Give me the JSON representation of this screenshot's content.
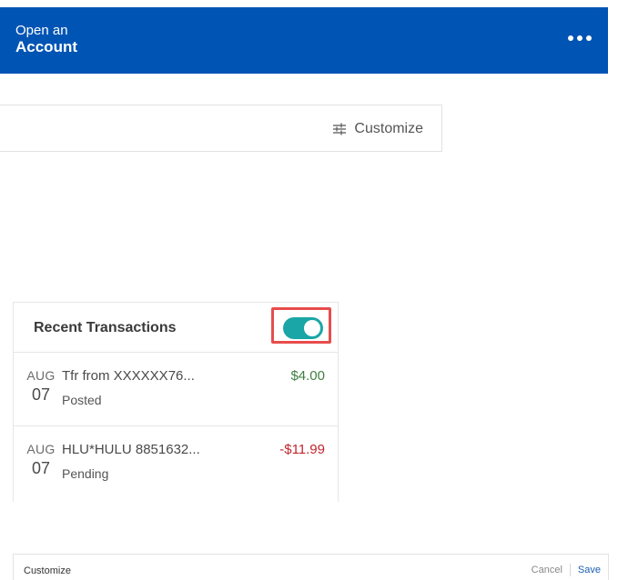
{
  "header": {
    "title_line1": "Open an",
    "title_line2": "Account",
    "menu_icon": "more-horizontal-icon",
    "background": "#0054b4"
  },
  "customize_bar": {
    "label": "Customize",
    "icon": "sliders-icon"
  },
  "transactions": {
    "title": "Recent Transactions",
    "toggle_on": true,
    "toggle_color": "#1aa6a6",
    "items": [
      {
        "month": "AUG",
        "day": "07",
        "description": "Tfr from XXXXXX76...",
        "status": "Posted",
        "amount": "$4.00"
      },
      {
        "month": "AUG",
        "day": "07",
        "description": "HLU*HULU 8851632...",
        "status": "Pending",
        "amount": "-$11.99"
      }
    ]
  },
  "footer": {
    "title": "Customize",
    "cancel_label": "Cancel",
    "save_label": "Save"
  }
}
